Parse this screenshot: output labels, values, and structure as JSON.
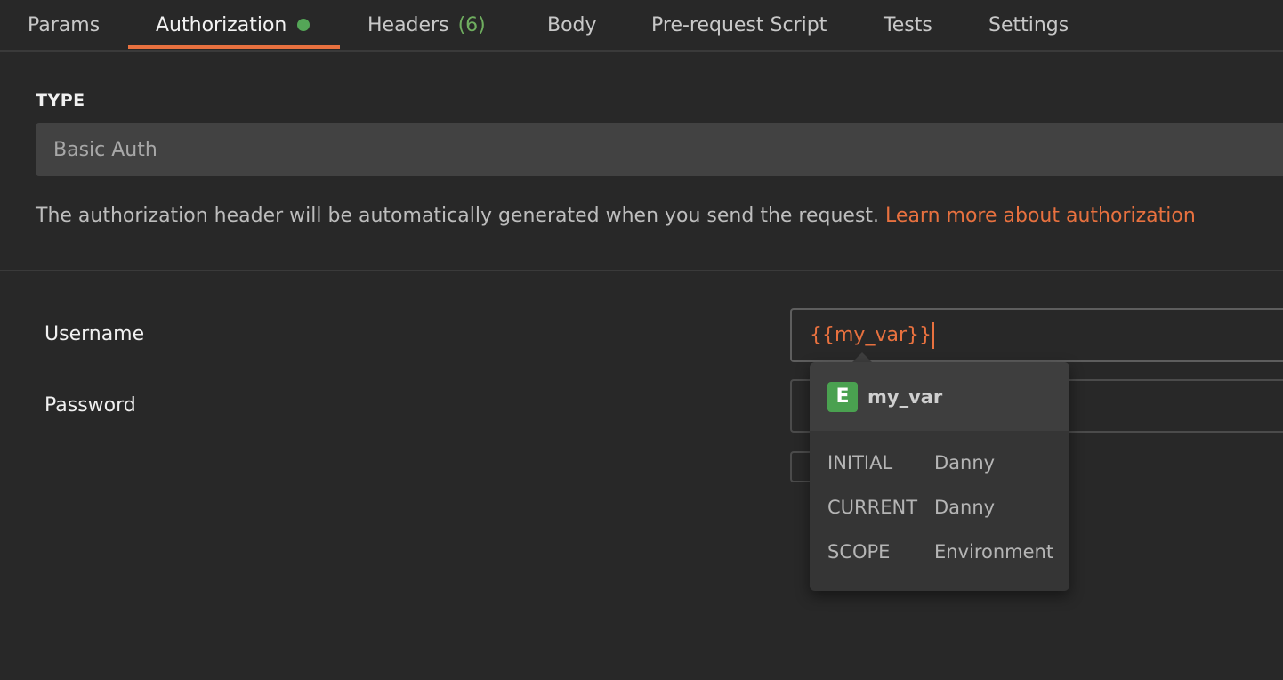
{
  "tabs": [
    {
      "label": "Params"
    },
    {
      "label": "Authorization"
    },
    {
      "label": "Headers",
      "count": "(6)"
    },
    {
      "label": "Body"
    },
    {
      "label": "Pre-request Script"
    },
    {
      "label": "Tests"
    },
    {
      "label": "Settings"
    }
  ],
  "auth": {
    "type_label": "TYPE",
    "type_value": "Basic Auth",
    "help_text": "The authorization header will be automatically generated when you send the request.",
    "help_link": "Learn more about authorization"
  },
  "form": {
    "username_label": "Username",
    "username_value": "{{my_var}}",
    "password_label": "Password"
  },
  "popover": {
    "badge": "E",
    "var_name": "my_var",
    "rows": [
      {
        "key": "INITIAL",
        "value": "Danny"
      },
      {
        "key": "CURRENT",
        "value": "Danny"
      },
      {
        "key": "SCOPE",
        "value": "Environment"
      }
    ]
  },
  "colors": {
    "accent": "#e8713f",
    "active_dot": "#54a657",
    "count": "#6fae5f",
    "env_badge": "#4aa150",
    "background": "#282828"
  }
}
